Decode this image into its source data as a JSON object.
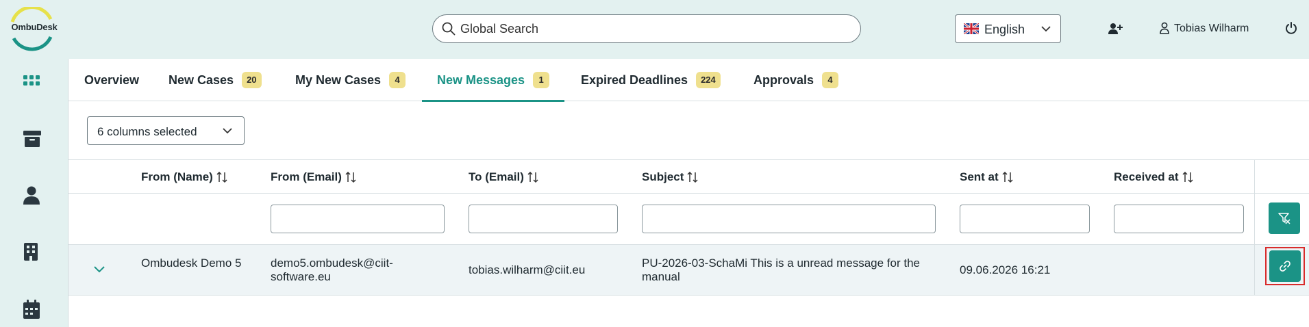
{
  "header": {
    "logo_text": "OmbuDesk",
    "search_placeholder": "Global Search",
    "language": "English",
    "user_name": "Tobias Wilharm"
  },
  "sidebar": {
    "items": [
      "dashboard-icon",
      "archive-icon",
      "person-icon",
      "building-icon",
      "calendar-icon"
    ]
  },
  "tabs": [
    {
      "label": "Overview",
      "badge": ""
    },
    {
      "label": "New Cases",
      "badge": "20"
    },
    {
      "label": "My New Cases",
      "badge": "4"
    },
    {
      "label": "New Messages",
      "badge": "1",
      "active": true
    },
    {
      "label": "Expired Deadlines",
      "badge": "224"
    },
    {
      "label": "Approvals",
      "badge": "4"
    }
  ],
  "column_selector": "6 columns selected",
  "table": {
    "columns": [
      "From (Name)",
      "From (Email)",
      "To (Email)",
      "Subject",
      "Sent at",
      "Received at"
    ],
    "rows": [
      {
        "from_name": "Ombudesk Demo 5",
        "from_email": "demo5.ombudesk@ciit-software.eu",
        "to_email": "tobias.wilharm@ciit.eu",
        "subject": "PU-2026-03-SchaMi This is a unread message for the manual",
        "sent_at": "09.06.2026 16:21",
        "received_at": ""
      }
    ]
  },
  "colors": {
    "accent": "#1b9386",
    "header_bg": "#e3f1f0",
    "badge_bg": "#efe08e",
    "highlight": "#d92b2b"
  }
}
